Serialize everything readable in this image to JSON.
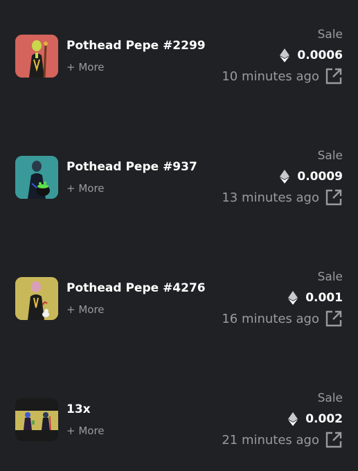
{
  "colors": {
    "background": "#202124",
    "primary_text": "#ffffff",
    "secondary_text": "#9a9b9f"
  },
  "items": [
    {
      "name": "Pothead Pepe #2299",
      "more": "+ More",
      "event": "Sale",
      "price": "0.0006",
      "time": "10 minutes ago",
      "thumb_bg": "#d4645c",
      "icon": "ethereum-icon"
    },
    {
      "name": "Pothead Pepe #937",
      "more": "+ More",
      "event": "Sale",
      "price": "0.0009",
      "time": "13 minutes ago",
      "thumb_bg": "#3a9a9a",
      "icon": "ethereum-icon"
    },
    {
      "name": "Pothead Pepe #4276",
      "more": "+ More",
      "event": "Sale",
      "price": "0.001",
      "time": "16 minutes ago",
      "thumb_bg": "#c9b85a",
      "icon": "ethereum-icon"
    },
    {
      "name": "13x",
      "more": "+ More",
      "event": "Sale",
      "price": "0.002",
      "time": "21 minutes ago",
      "thumb_bg": "#c9b85a",
      "icon": "ethereum-icon"
    }
  ]
}
